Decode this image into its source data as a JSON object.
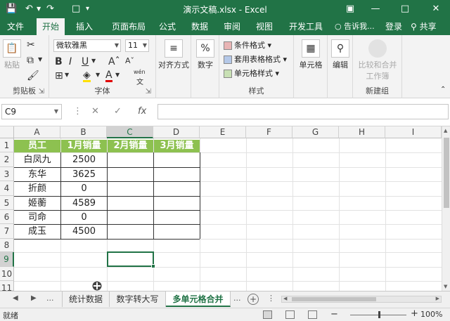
{
  "window": {
    "title": "演示文稿.xlsx - Excel"
  },
  "ribbon_tabs": [
    "文件",
    "开始",
    "插入",
    "页面布局",
    "公式",
    "数据",
    "审阅",
    "视图",
    "开发工具"
  ],
  "tell_me": "告诉我...",
  "login": "登录",
  "share": "共享",
  "clipboard": {
    "paste": "粘贴",
    "label": "剪贴板"
  },
  "font": {
    "name": "微软雅黑",
    "size": "11",
    "label": "字体",
    "font_color_glyph": "A",
    "phonetic": "wén"
  },
  "alignment": {
    "label": "对齐方式"
  },
  "number": {
    "label": "数字",
    "glyph": "%"
  },
  "styles": {
    "label": "样式",
    "conditional": "条件格式",
    "table_format": "套用表格格式",
    "cell_styles": "单元格样式"
  },
  "cells": {
    "label": "单元格"
  },
  "editing": {
    "label": "编辑"
  },
  "new_group": {
    "compare_merge_line1": "比较和合并",
    "compare_merge_line2": "工作簿",
    "label": "新建组"
  },
  "formula_bar": {
    "name_box": "C9",
    "fx": "fx",
    "content": ""
  },
  "grid": {
    "columns": [
      "A",
      "B",
      "C",
      "D",
      "E",
      "F",
      "G",
      "H",
      "I"
    ],
    "rows": [
      "1",
      "2",
      "3",
      "4",
      "5",
      "6",
      "7",
      "8",
      "9",
      "10",
      "11"
    ],
    "selected_cell": "C9",
    "header_row": [
      "员工",
      "1月销量",
      "2月销量",
      "3月销量"
    ],
    "data": [
      {
        "name": "白凤九",
        "jan": "2500"
      },
      {
        "name": "东华",
        "jan": "3625"
      },
      {
        "name": "折颜",
        "jan": "0"
      },
      {
        "name": "姬蘅",
        "jan": "4589"
      },
      {
        "name": "司命",
        "jan": "0"
      },
      {
        "name": "成玉",
        "jan": "4500"
      }
    ]
  },
  "sheets": {
    "ellipsis": "...",
    "tabs": [
      "统计数据",
      "数字转大写",
      "多单元格合并"
    ],
    "active": "多单元格合并"
  },
  "status": {
    "ready": "就绪",
    "zoom": "100%"
  },
  "colors": {
    "excel_green": "#217346",
    "header_fill": "#8dc150"
  }
}
